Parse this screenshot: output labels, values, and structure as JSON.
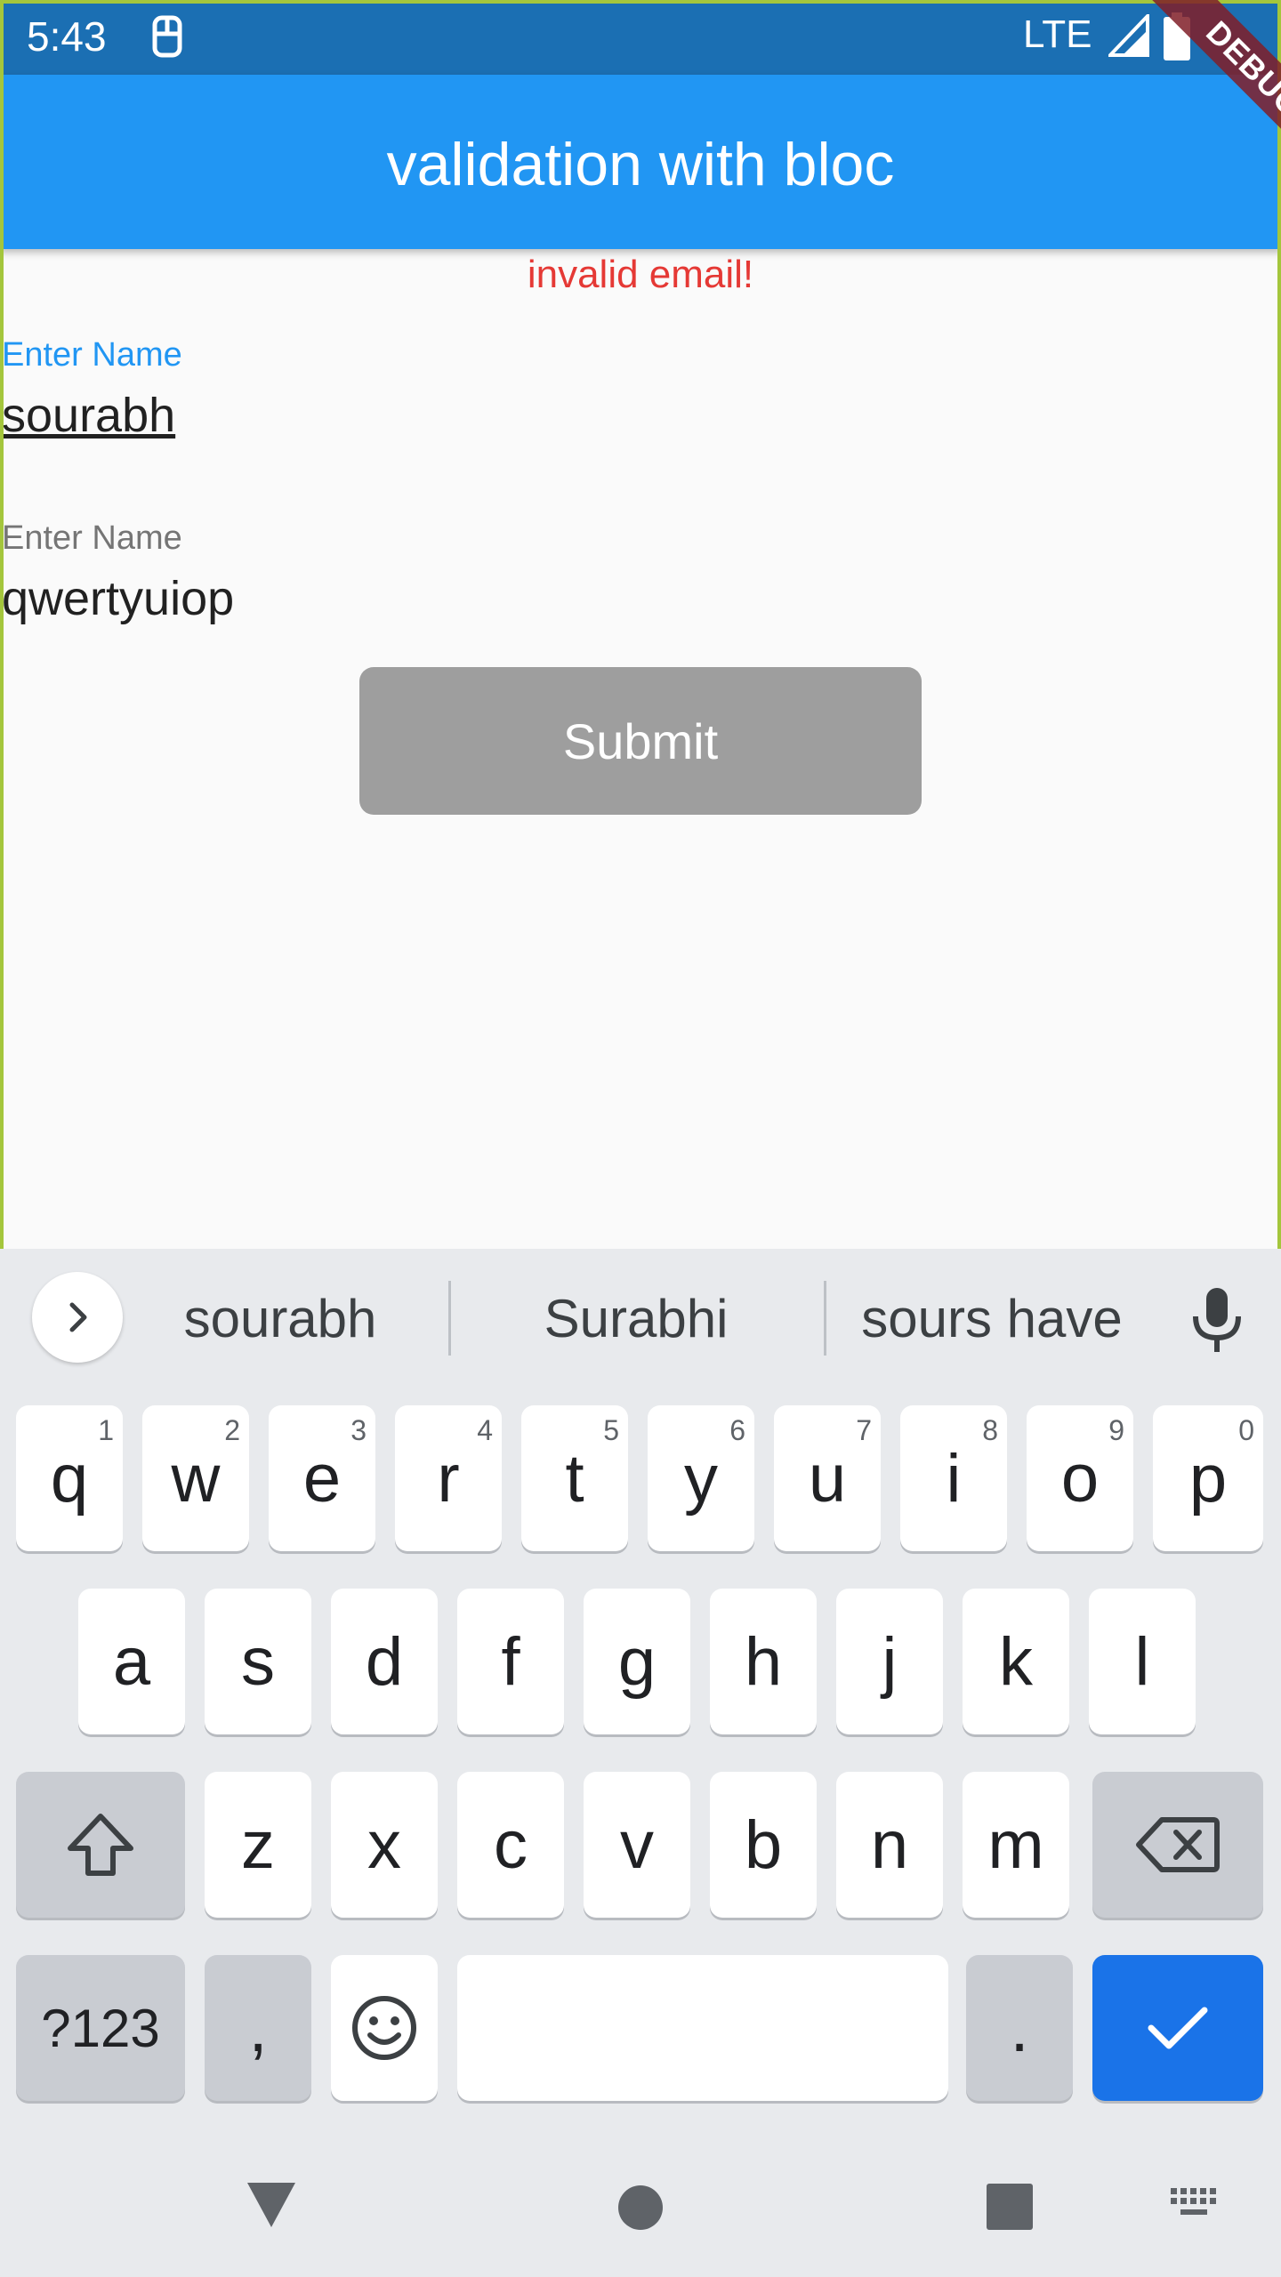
{
  "status_bar": {
    "time": "5:43",
    "network": "LTE"
  },
  "debug_banner": "DEBUG",
  "app_bar": {
    "title": "validation with bloc"
  },
  "form": {
    "error": "invalid email!",
    "name_label": "Enter Name",
    "name_value": "sourabh",
    "email_label": "Enter Name",
    "email_value": "qwertyuiop",
    "submit_label": "Submit"
  },
  "keyboard": {
    "suggestions": [
      "sourabh",
      "Surabhi",
      "sours have"
    ],
    "row1": [
      {
        "key": "q",
        "hint": "1"
      },
      {
        "key": "w",
        "hint": "2"
      },
      {
        "key": "e",
        "hint": "3"
      },
      {
        "key": "r",
        "hint": "4"
      },
      {
        "key": "t",
        "hint": "5"
      },
      {
        "key": "y",
        "hint": "6"
      },
      {
        "key": "u",
        "hint": "7"
      },
      {
        "key": "i",
        "hint": "8"
      },
      {
        "key": "o",
        "hint": "9"
      },
      {
        "key": "p",
        "hint": "0"
      }
    ],
    "row2": [
      "a",
      "s",
      "d",
      "f",
      "g",
      "h",
      "j",
      "k",
      "l"
    ],
    "row3": [
      "z",
      "x",
      "c",
      "v",
      "b",
      "n",
      "m"
    ],
    "symbols_label": "?123",
    "comma": ",",
    "period": "."
  },
  "colors": {
    "app_bar": "#2196f3",
    "status_bar": "#1b6fb3",
    "error": "#e53935",
    "action_key": "#1a73e8"
  }
}
